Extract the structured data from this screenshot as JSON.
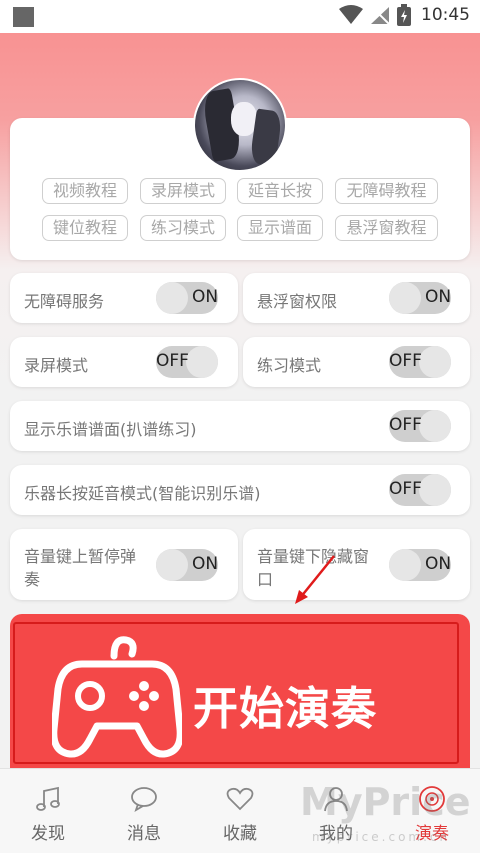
{
  "status_bar": {
    "time": "10:45"
  },
  "tags": [
    {
      "label": "视频教程"
    },
    {
      "label": "录屏模式"
    },
    {
      "label": "延音长按"
    },
    {
      "label": "无障碍教程"
    },
    {
      "label": "键位教程"
    },
    {
      "label": "练习模式"
    },
    {
      "label": "显示谱面"
    },
    {
      "label": "悬浮窗教程"
    }
  ],
  "settings": {
    "accessibility": {
      "label": "无障碍服务",
      "state": "ON"
    },
    "floating_window": {
      "label": "悬浮窗权限",
      "state": "ON"
    },
    "recording": {
      "label": "录屏模式",
      "state": "OFF"
    },
    "practice": {
      "label": "练习模式",
      "state": "OFF"
    },
    "show_score": {
      "label": "显示乐谱谱面(扒谱练习)",
      "state": "OFF"
    },
    "sustain": {
      "label": "乐器长按延音模式(智能识别乐谱)",
      "state": "OFF"
    },
    "volume_up": {
      "label_line1": "音量键上暂停弹",
      "label_line2": "奏",
      "state": "ON"
    },
    "volume_down": {
      "label_line1": "音量键下隐藏窗",
      "label_line2": "口",
      "state": "ON"
    }
  },
  "start_button": {
    "label": "开始演奏",
    "icon": "gamepad-icon"
  },
  "bottom_nav": [
    {
      "label": "发现",
      "icon": "music-note-icon"
    },
    {
      "label": "消息",
      "icon": "chat-bubble-icon"
    },
    {
      "label": "收藏",
      "icon": "heart-icon"
    },
    {
      "label": "我的",
      "icon": "person-icon"
    },
    {
      "label": "演奏",
      "icon": "disc-icon",
      "active": true
    }
  ],
  "watermark": {
    "text": "MyPrice",
    "sub": "myprice.com.cn"
  },
  "colors": {
    "accent": "#f44848",
    "active_nav": "#e23a3a",
    "header_gradient": "#f98d8d"
  }
}
